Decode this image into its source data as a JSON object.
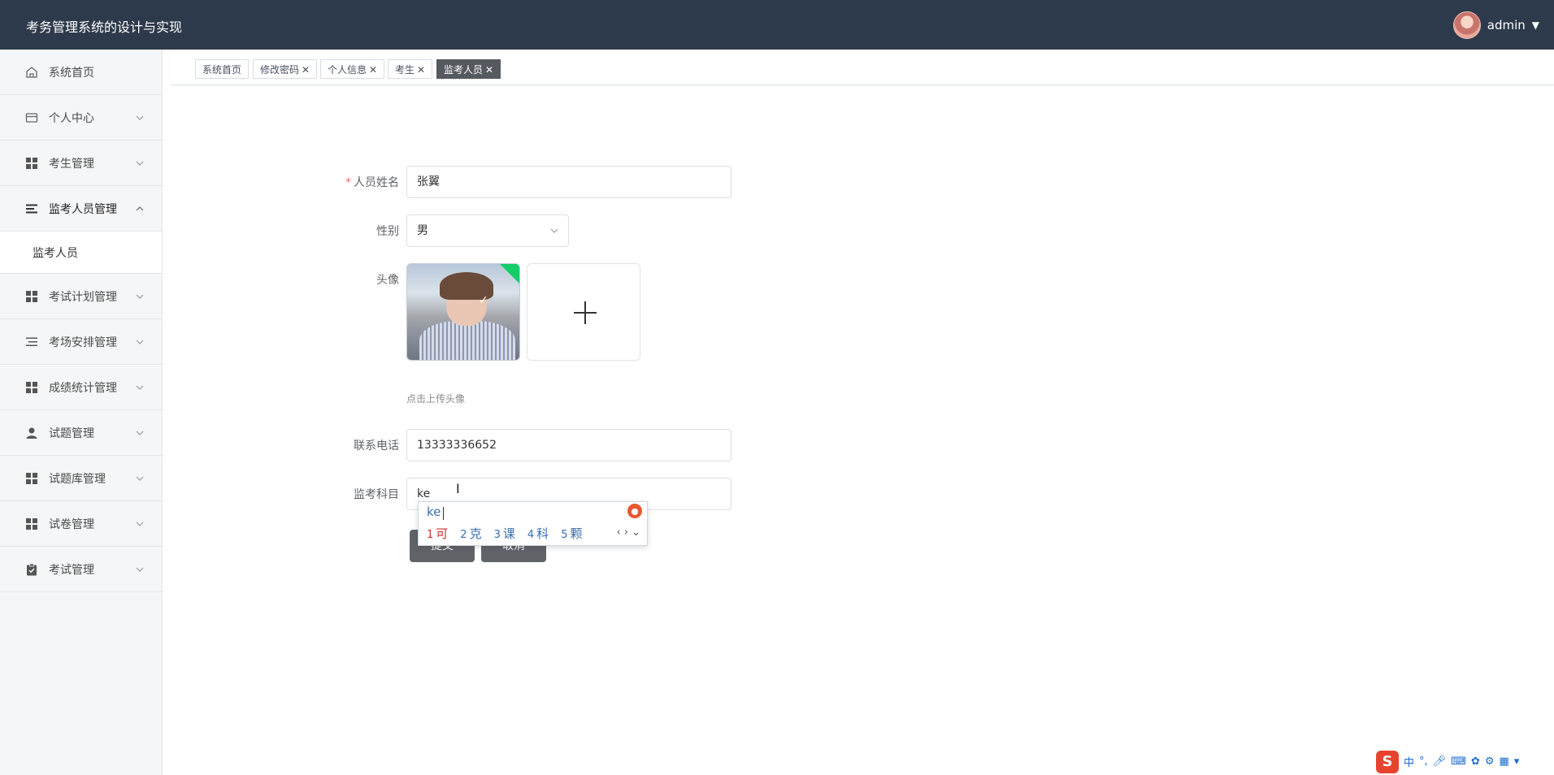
{
  "app_title": "考务管理系统的设计与实现",
  "user": {
    "name": "admin"
  },
  "sidebar": {
    "items": [
      {
        "label": "系统首页",
        "icon": "home-icon"
      },
      {
        "label": "个人中心",
        "icon": "wallet-icon"
      },
      {
        "label": "考生管理",
        "icon": "grid-icon"
      },
      {
        "label": "监考人员管理",
        "icon": "list-icon"
      },
      {
        "label": "考试计划管理",
        "icon": "grid-icon"
      },
      {
        "label": "考场安排管理",
        "icon": "list-icon"
      },
      {
        "label": "成绩统计管理",
        "icon": "grid-icon"
      },
      {
        "label": "试题管理",
        "icon": "user-icon"
      },
      {
        "label": "试题库管理",
        "icon": "grid-icon"
      },
      {
        "label": "试卷管理",
        "icon": "grid-icon"
      },
      {
        "label": "考试管理",
        "icon": "clipboard-icon"
      }
    ],
    "submenu": {
      "label": "监考人员"
    }
  },
  "tags": [
    {
      "label": "系统首页"
    },
    {
      "label": "修改密码"
    },
    {
      "label": "个人信息"
    },
    {
      "label": "考生"
    },
    {
      "label": "监考人员"
    }
  ],
  "form": {
    "name_label": "人员姓名",
    "name_value": "张翼",
    "gender_label": "性别",
    "gender_value": "男",
    "avatar_label": "头像",
    "avatar_hint": "点击上传头像",
    "phone_label": "联系电话",
    "phone_value": "13333336652",
    "subject_label": "监考科目",
    "subject_value": "ke"
  },
  "buttons": {
    "submit": "提交",
    "cancel": "取消"
  },
  "ime": {
    "composition": "ke",
    "candidates": [
      {
        "n": "1",
        "text": "可"
      },
      {
        "n": "2",
        "text": "克"
      },
      {
        "n": "3",
        "text": "课"
      },
      {
        "n": "4",
        "text": "科"
      },
      {
        "n": "5",
        "text": "颗"
      }
    ]
  },
  "tray": {
    "mode": "中",
    "punct": "°,"
  }
}
